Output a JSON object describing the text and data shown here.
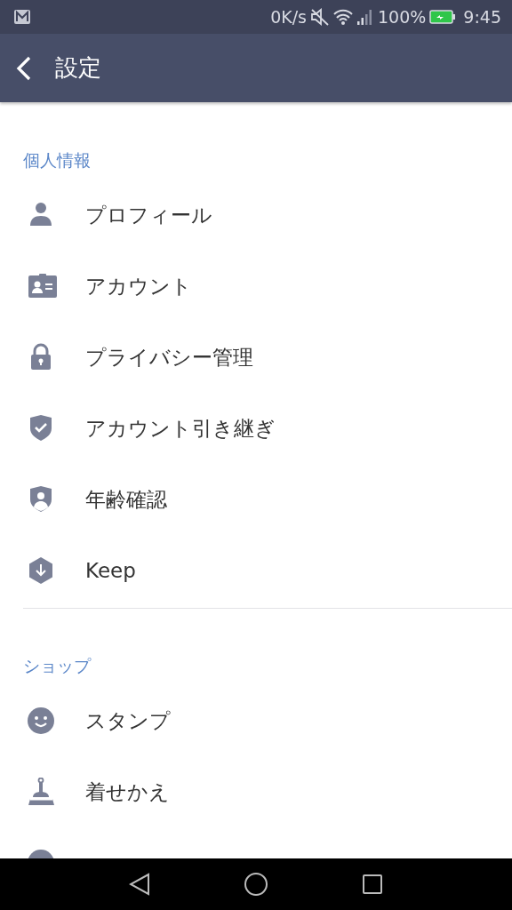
{
  "status_bar": {
    "speed": "0K/s",
    "battery": "100%",
    "time": "9:45"
  },
  "app_bar": {
    "title": "設定"
  },
  "sections": [
    {
      "title": "個人情報",
      "items": [
        {
          "label": "プロフィール"
        },
        {
          "label": "アカウント"
        },
        {
          "label": "プライバシー管理"
        },
        {
          "label": "アカウント引き継ぎ"
        },
        {
          "label": "年齢確認"
        },
        {
          "label": "Keep"
        }
      ]
    },
    {
      "title": "ショップ",
      "items": [
        {
          "label": "スタンプ"
        },
        {
          "label": "着せかえ"
        }
      ]
    }
  ]
}
